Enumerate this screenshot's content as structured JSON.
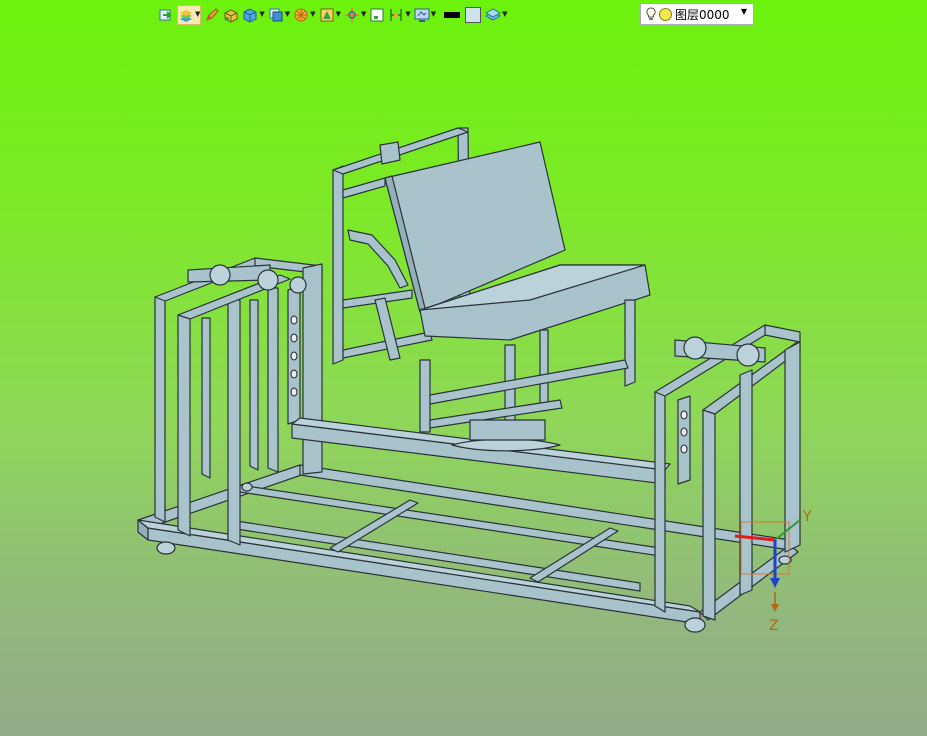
{
  "toolbar": {
    "buttons": [
      {
        "icon": "layer-manager-icon"
      },
      {
        "icon": "layer-palette-icon",
        "active": true,
        "dropdown": true
      },
      {
        "icon": "pencil-icon"
      },
      {
        "icon": "box-solid-icon"
      },
      {
        "icon": "cube-icon",
        "dropdown": true
      },
      {
        "icon": "view-cube-icon",
        "dropdown": true
      },
      {
        "icon": "render-wheel-icon",
        "dropdown": true
      },
      {
        "icon": "shaded-view-icon",
        "dropdown": true
      },
      {
        "icon": "move-axes-icon",
        "dropdown": true
      },
      {
        "icon": "frame-view-icon"
      },
      {
        "icon": "section-view-icon",
        "dropdown": true
      },
      {
        "icon": "display-mode-icon",
        "dropdown": true
      }
    ],
    "line_color": "#000000",
    "fill_color": "#cfe3ee",
    "layer_icon": "layer-stack-icon",
    "layer_combo": {
      "value": "图层0000",
      "bulb_icon": "lightbulb-icon",
      "state_icon": "sun-icon"
    }
  },
  "triad": {
    "y_label": "Y",
    "z_label": "Z"
  },
  "colors": {
    "steel": "#a9c3cd",
    "steel_dark": "#2a3338",
    "bg_top": "#6cf20c",
    "bg_bottom": "#93aa88"
  }
}
